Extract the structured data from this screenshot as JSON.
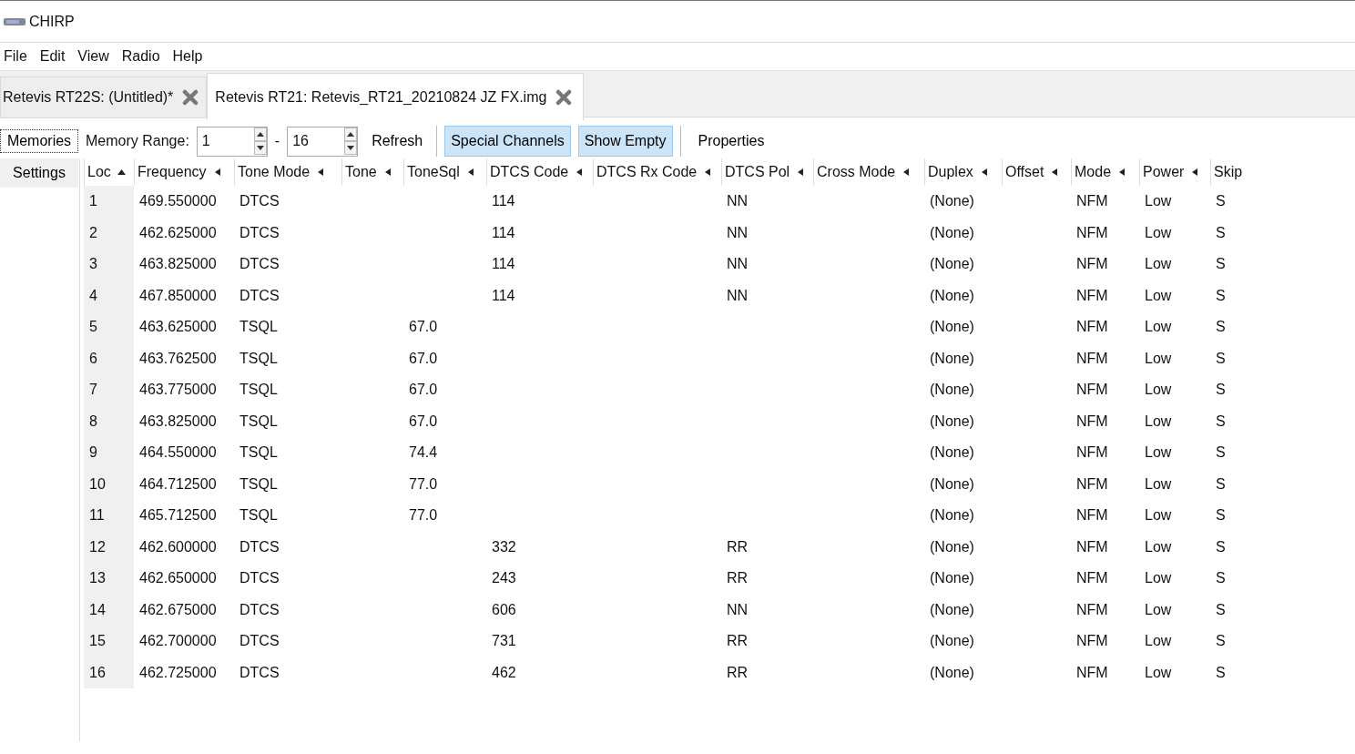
{
  "window": {
    "title": "CHIRP"
  },
  "menu": [
    "File",
    "Edit",
    "View",
    "Radio",
    "Help"
  ],
  "tabs": [
    {
      "label": "Retevis RT22S: (Untitled)*",
      "selected": false
    },
    {
      "label": "Retevis RT21: Retevis_RT21_20210824 JZ FX.img",
      "selected": true
    }
  ],
  "side_tabs": [
    {
      "label": "Memories",
      "selected": true
    },
    {
      "label": "Settings",
      "selected": false
    }
  ],
  "toolbar": {
    "range_label": "Memory Range:",
    "range_from": "1",
    "range_separator": "-",
    "range_to": "16",
    "refresh": "Refresh",
    "toggles": [
      {
        "label": "Special Channels",
        "on": true
      },
      {
        "label": "Show Empty",
        "on": true
      }
    ],
    "properties": "Properties"
  },
  "table": {
    "columns": [
      {
        "label": "Loc",
        "sorted": true
      },
      {
        "label": "Frequency",
        "sorted": false
      },
      {
        "label": "Tone Mode",
        "sorted": false
      },
      {
        "label": "Tone",
        "sorted": false
      },
      {
        "label": "ToneSql",
        "sorted": false
      },
      {
        "label": "DTCS Code",
        "sorted": false
      },
      {
        "label": "DTCS Rx Code",
        "sorted": false
      },
      {
        "label": "DTCS Pol",
        "sorted": false
      },
      {
        "label": "Cross Mode",
        "sorted": false
      },
      {
        "label": "Duplex",
        "sorted": false
      },
      {
        "label": "Offset",
        "sorted": false
      },
      {
        "label": "Mode",
        "sorted": false
      },
      {
        "label": "Power",
        "sorted": false
      },
      {
        "label": "Skip"
      }
    ],
    "rows": [
      [
        "1",
        "469.550000",
        "DTCS",
        null,
        null,
        "114",
        null,
        "NN",
        null,
        "(None)",
        null,
        "NFM",
        "Low",
        "S"
      ],
      [
        "2",
        "462.625000",
        "DTCS",
        null,
        null,
        "114",
        null,
        "NN",
        null,
        "(None)",
        null,
        "NFM",
        "Low",
        "S"
      ],
      [
        "3",
        "463.825000",
        "DTCS",
        null,
        null,
        "114",
        null,
        "NN",
        null,
        "(None)",
        null,
        "NFM",
        "Low",
        "S"
      ],
      [
        "4",
        "467.850000",
        "DTCS",
        null,
        null,
        "114",
        null,
        "NN",
        null,
        "(None)",
        null,
        "NFM",
        "Low",
        "S"
      ],
      [
        "5",
        "463.625000",
        "TSQL",
        null,
        "67.0",
        null,
        null,
        null,
        null,
        "(None)",
        null,
        "NFM",
        "Low",
        "S"
      ],
      [
        "6",
        "463.762500",
        "TSQL",
        null,
        "67.0",
        null,
        null,
        null,
        null,
        "(None)",
        null,
        "NFM",
        "Low",
        "S"
      ],
      [
        "7",
        "463.775000",
        "TSQL",
        null,
        "67.0",
        null,
        null,
        null,
        null,
        "(None)",
        null,
        "NFM",
        "Low",
        "S"
      ],
      [
        "8",
        "463.825000",
        "TSQL",
        null,
        "67.0",
        null,
        null,
        null,
        null,
        "(None)",
        null,
        "NFM",
        "Low",
        "S"
      ],
      [
        "9",
        "464.550000",
        "TSQL",
        null,
        "74.4",
        null,
        null,
        null,
        null,
        "(None)",
        null,
        "NFM",
        "Low",
        "S"
      ],
      [
        "10",
        "464.712500",
        "TSQL",
        null,
        "77.0",
        null,
        null,
        null,
        null,
        "(None)",
        null,
        "NFM",
        "Low",
        "S"
      ],
      [
        "11",
        "465.712500",
        "TSQL",
        null,
        "77.0",
        null,
        null,
        null,
        null,
        "(None)",
        null,
        "NFM",
        "Low",
        "S"
      ],
      [
        "12",
        "462.600000",
        "DTCS",
        null,
        null,
        "332",
        null,
        "RR",
        null,
        "(None)",
        null,
        "NFM",
        "Low",
        "S"
      ],
      [
        "13",
        "462.650000",
        "DTCS",
        null,
        null,
        "243",
        null,
        "RR",
        null,
        "(None)",
        null,
        "NFM",
        "Low",
        "S"
      ],
      [
        "14",
        "462.675000",
        "DTCS",
        null,
        null,
        "606",
        null,
        "NN",
        null,
        "(None)",
        null,
        "NFM",
        "Low",
        "S"
      ],
      [
        "15",
        "462.700000",
        "DTCS",
        null,
        null,
        "731",
        null,
        "RR",
        null,
        "(None)",
        null,
        "NFM",
        "Low",
        "S"
      ],
      [
        "16",
        "462.725000",
        "DTCS",
        null,
        null,
        "462",
        null,
        "RR",
        null,
        "(None)",
        null,
        "NFM",
        "Low",
        "S"
      ]
    ]
  }
}
